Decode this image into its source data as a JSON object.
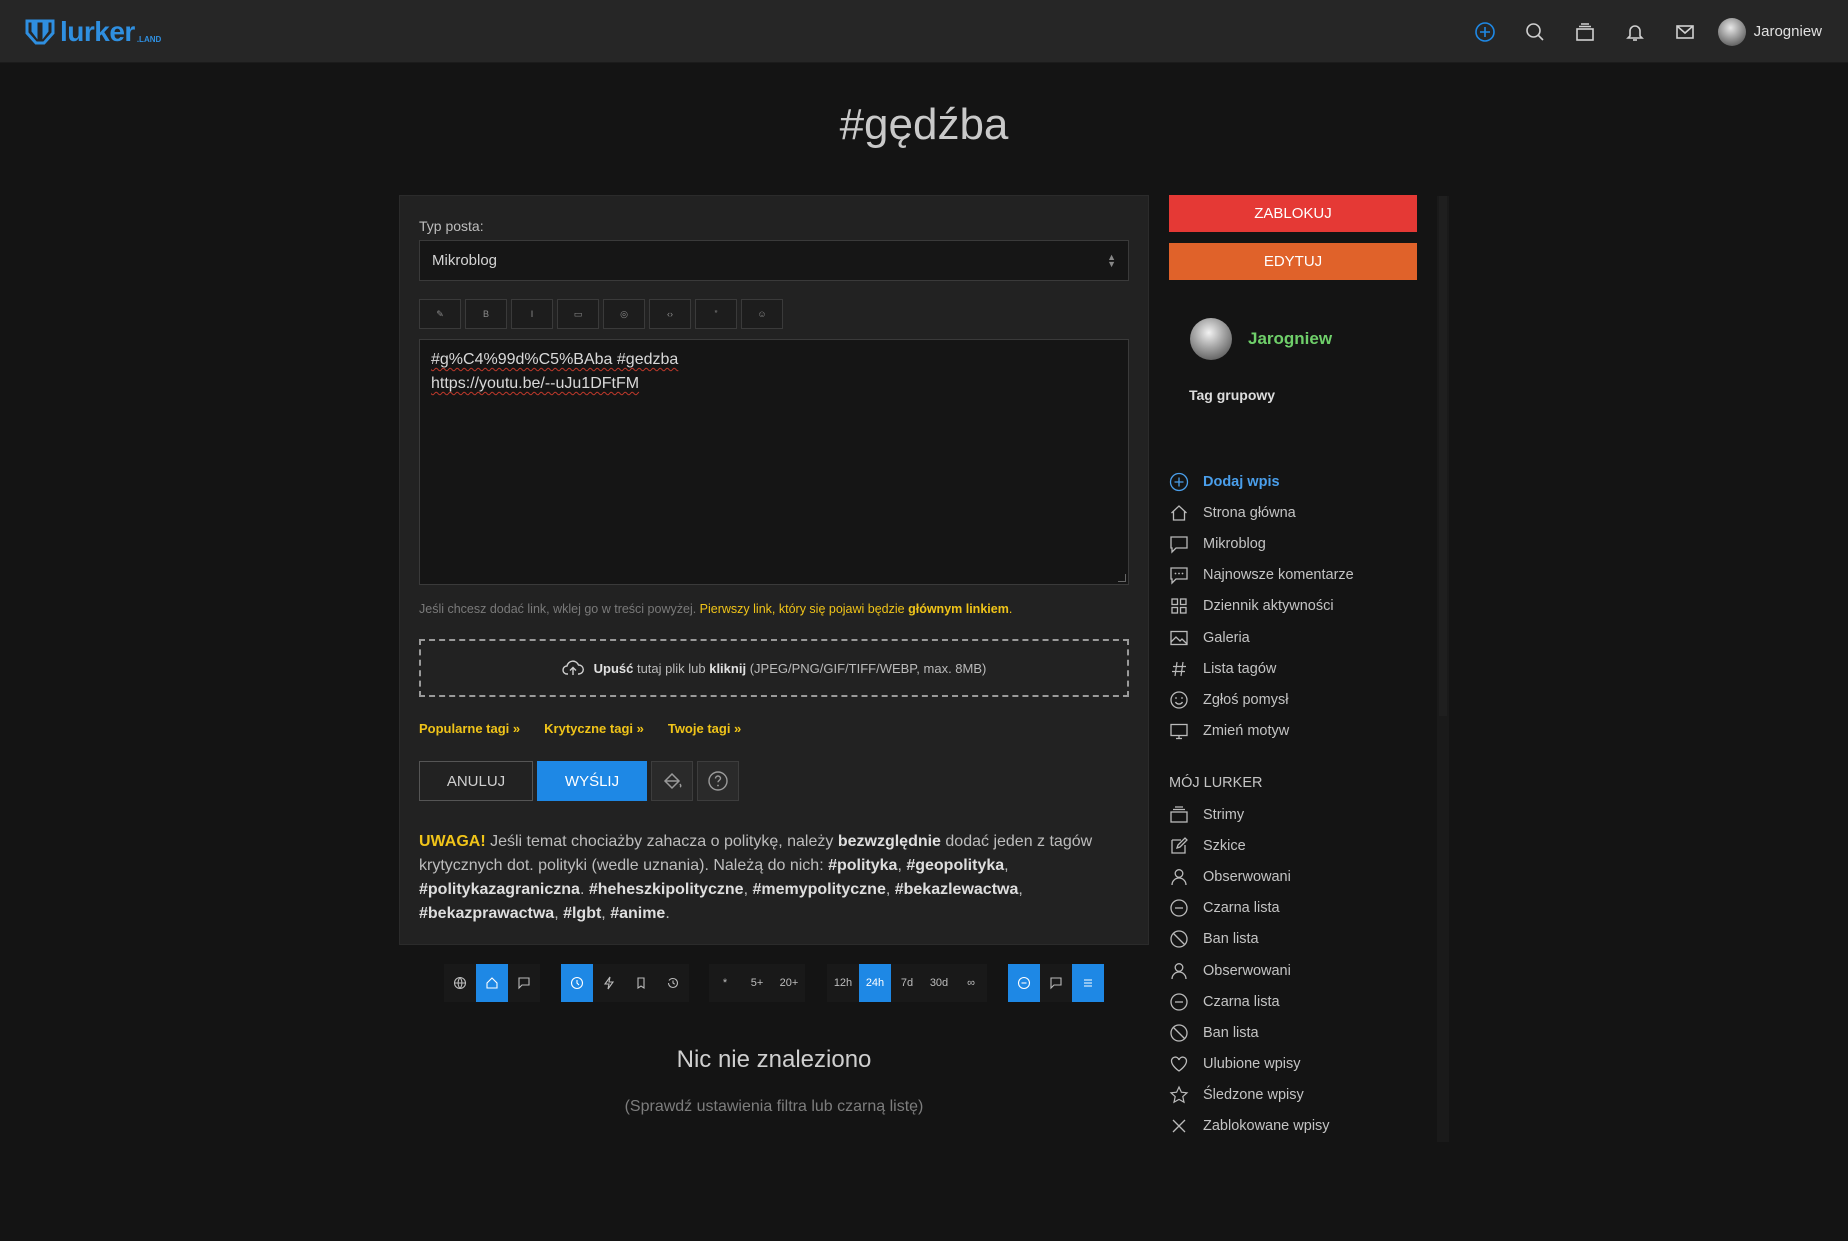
{
  "topbar": {
    "logo_word": "lurker",
    "logo_suffix": ".LAND",
    "username": "Jarogniew",
    "icons": [
      "add-circle-icon",
      "search-icon",
      "streams-icon",
      "bell-icon",
      "mail-icon"
    ]
  },
  "page": {
    "title": "#gędźba"
  },
  "form": {
    "post_type_label": "Typ posta:",
    "post_type_value": "Mikroblog",
    "toolbar": [
      "✎",
      "B",
      "I",
      "▭",
      "◎",
      "‹›",
      "”",
      "☺"
    ],
    "editor_line1": "#g%C4%99d%C5%BAba  #gedzba",
    "editor_line2": "https://youtu.be/--uJu1DFtFM",
    "hint_prefix": "Jeśli chcesz dodać link, wklej go w treści powyżej. ",
    "hint_yellow": "Pierwszy link, który się pojawi będzie ",
    "hint_bold": "głównym linkiem",
    "hint_dot": ".",
    "drop_bold1": "Upuść",
    "drop_text1": " tutaj plik lub ",
    "drop_bold2": "kliknij",
    "drop_text2": " (JPEG/PNG/GIF/TIFF/WEBP, max. 8MB)",
    "tag_links": [
      "Popularne tagi »",
      "Krytyczne tagi »",
      "Twoje tagi »"
    ],
    "cancel_label": "ANULUJ",
    "send_label": "WYŚLIJ",
    "warning": {
      "uwaga": "UWAGA!",
      "t1": " Jeśli temat chociażby zahacza o politykę, należy ",
      "b1": "bezwzględnie",
      "t2": " dodać jeden z tagów krytycznych dot. polityki (wedle uznania). Należą do nich: ",
      "b2": "#polityka",
      "s1": ", ",
      "b3": "#geopolityka",
      "s2": ", ",
      "b4": "#politykazagraniczna",
      "s3": ". ",
      "b5": "#heheszkipolityczne",
      "s4": ", ",
      "b6": "#memypolityczne",
      "s5": ", ",
      "b7": "#bekazlewactwa",
      "s6": ", ",
      "b8": "#bekazprawactwa",
      "s7": ", ",
      "b9": "#lgbt",
      "s8": ", ",
      "b10": "#anime",
      "s9": "."
    }
  },
  "filters": {
    "group1": [
      "globe-icon",
      "home-icon",
      "comment-icon"
    ],
    "group2": [
      "clock-icon",
      "bolt-icon",
      "bookmark-icon",
      "history-icon"
    ],
    "group3": [
      "*",
      "5+",
      "20+"
    ],
    "group4": [
      "12h",
      "24h",
      "7d",
      "30d",
      "∞"
    ],
    "group5": [
      "minus-circle-icon",
      "comment-icon",
      "list-icon"
    ]
  },
  "empty": {
    "title": "Nic nie znaleziono",
    "subtitle": "(Sprawdź ustawienia filtra lub czarną listę)"
  },
  "sidebar": {
    "block_label": "ZABLOKUJ",
    "edit_label": "EDYTUJ",
    "owner": "Jarogniew",
    "tag_type": "Tag grupowy",
    "nav": [
      {
        "label": "Dodaj wpis",
        "icon": "add-circle-icon"
      },
      {
        "label": "Strona główna",
        "icon": "home-icon"
      },
      {
        "label": "Mikroblog",
        "icon": "comment-icon"
      },
      {
        "label": "Najnowsze komentarze",
        "icon": "comments-icon"
      },
      {
        "label": "Dziennik aktywności",
        "icon": "grid-icon"
      },
      {
        "label": "Galeria",
        "icon": "image-icon"
      },
      {
        "label": "Lista tagów",
        "icon": "hash-icon"
      },
      {
        "label": "Zgłoś pomysł",
        "icon": "smile-icon"
      },
      {
        "label": "Zmień motyw",
        "icon": "monitor-icon"
      }
    ],
    "my_lurker_heading": "MÓJ LURKER",
    "my_lurker": [
      {
        "label": "Strimy",
        "icon": "streams-icon"
      },
      {
        "label": "Szkice",
        "icon": "edit-icon"
      },
      {
        "label": "Obserwowani",
        "icon": "user-icon"
      },
      {
        "label": "Czarna lista",
        "icon": "minus-circle-icon"
      },
      {
        "label": "Ban lista",
        "icon": "ban-icon"
      },
      {
        "label": "Obserwowani",
        "icon": "user-icon"
      },
      {
        "label": "Czarna lista",
        "icon": "minus-circle-icon"
      },
      {
        "label": "Ban lista",
        "icon": "ban-icon"
      },
      {
        "label": "Ulubione wpisy",
        "icon": "heart-icon"
      },
      {
        "label": "Śledzone wpisy",
        "icon": "star-icon"
      },
      {
        "label": "Zablokowane wpisy",
        "icon": "x-icon"
      }
    ]
  },
  "colors": {
    "accent": "#1e88e5",
    "block": "#e53935",
    "edit": "#e0622a",
    "yellow": "#f0c419",
    "owner": "#6fcf6a"
  }
}
